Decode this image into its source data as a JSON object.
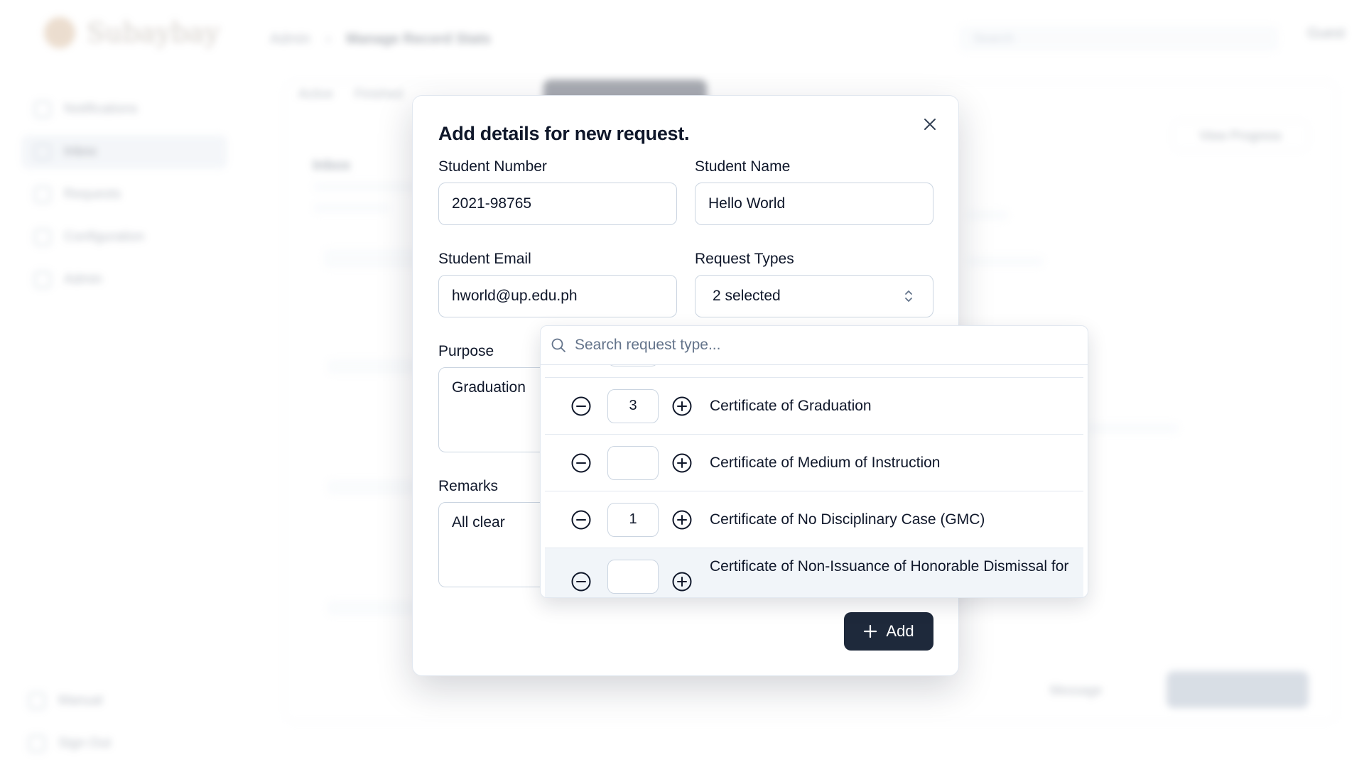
{
  "app": {
    "brand": "Subaybay",
    "breadcrumb": [
      "Admin",
      "Manage Record Stats"
    ],
    "search_placeholder": "Search",
    "user_name": "Guest"
  },
  "sidebar": {
    "items": [
      {
        "label": "Notifications"
      },
      {
        "label": "Inbox"
      },
      {
        "label": "Requests"
      },
      {
        "label": "Configuration"
      },
      {
        "label": "Admin"
      }
    ],
    "footer": [
      {
        "label": "Manual"
      },
      {
        "label": "Sign Out"
      }
    ]
  },
  "background": {
    "tabs": [
      "Active",
      "Finished"
    ],
    "view_progress": "View Progress",
    "section_title": "Inbox",
    "message_label": "Message"
  },
  "dialog": {
    "title": "Add details for new request.",
    "student_number_label": "Student Number",
    "student_number_value": "2021-98765",
    "student_name_label": "Student Name",
    "student_name_value": "Hello World",
    "student_email_label": "Student Email",
    "student_email_value": "hworld@up.edu.ph",
    "request_types_label": "Request Types",
    "request_types_value": "2 selected",
    "purpose_label": "Purpose",
    "purpose_value": "Graduation",
    "remarks_label": "Remarks",
    "remarks_value": "All clear",
    "add_button": "Add"
  },
  "combobox": {
    "search_placeholder": "Search request type...",
    "items": [
      {
        "label": "Certificate of Graduation",
        "quantity": "3"
      },
      {
        "label": "Certificate of Medium of Instruction",
        "quantity": ""
      },
      {
        "label": "Certificate of No Disciplinary Case (GMC)",
        "quantity": "1"
      },
      {
        "label": "Certificate of Non-Issuance of Honorable Dismissal for",
        "quantity": ""
      }
    ]
  }
}
